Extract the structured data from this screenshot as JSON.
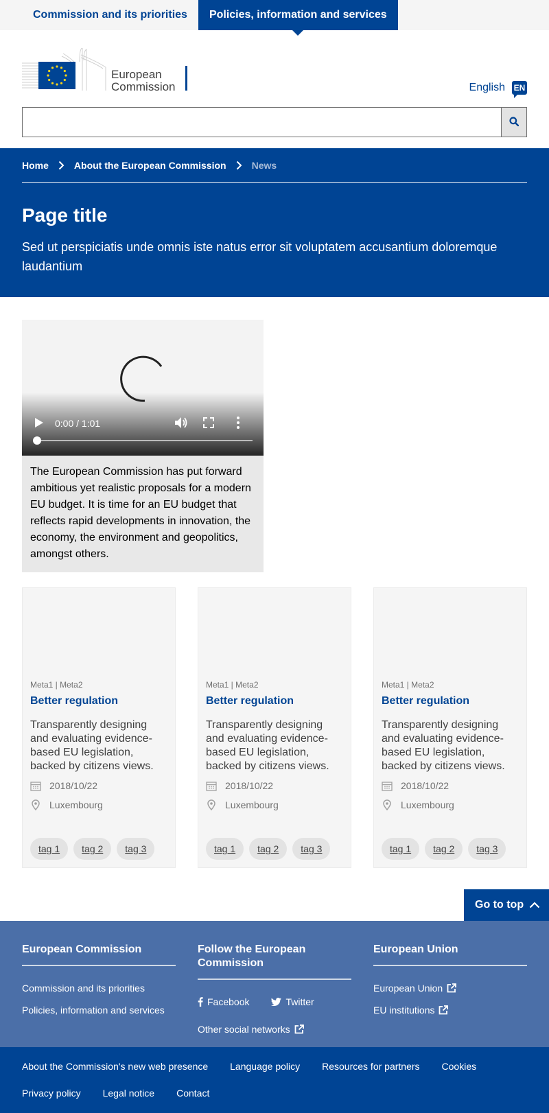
{
  "topnav": {
    "items": [
      {
        "label": "Commission and its priorities"
      },
      {
        "label": "Policies, information and services"
      }
    ]
  },
  "header": {
    "logo_line1": "European",
    "logo_line2": "Commission",
    "language_label": "English",
    "language_code": "EN",
    "search_placeholder": ""
  },
  "breadcrumb": [
    {
      "label": "Home"
    },
    {
      "label": "About the European Commission"
    },
    {
      "label": "News"
    }
  ],
  "page": {
    "title": "Page title",
    "intro": "Sed ut perspiciatis unde omnis iste natus error sit voluptatem accusantium doloremque laudantium"
  },
  "video": {
    "time": "0:00 / 1:01",
    "progress": 0,
    "caption": "The European Commission has put forward ambitious yet realistic proposals for a modern EU budget. It is time for an EU budget that reflects rapid developments in innovation, the economy, the environment and geopolitics, amongst others."
  },
  "cards": [
    {
      "meta": "Meta1 | Meta2",
      "title": "Better regulation",
      "description": "Transparently designing and evaluating evidence-based EU legislation, backed by citizens views.",
      "date": "2018/10/22",
      "location": "Luxembourg",
      "tags": [
        "tag 1",
        "tag 2",
        "tag 3"
      ]
    },
    {
      "meta": "Meta1 | Meta2",
      "title": "Better regulation",
      "description": "Transparently designing and evaluating evidence-based EU legislation, backed by citizens views.",
      "date": "2018/10/22",
      "location": "Luxembourg",
      "tags": [
        "tag 1",
        "tag 2",
        "tag 3"
      ]
    },
    {
      "meta": "Meta1 | Meta2",
      "title": "Better regulation",
      "description": "Transparently designing and evaluating evidence-based EU legislation, backed by citizens views.",
      "date": "2018/10/22",
      "location": "Luxembourg",
      "tags": [
        "tag 1",
        "tag 2",
        "tag 3"
      ]
    }
  ],
  "go_to_top": "Go to top",
  "footer": {
    "columns": [
      {
        "title": "European Commission",
        "links": [
          "Commission and its priorities",
          "Policies, information and services"
        ]
      },
      {
        "title": "Follow the European Commission",
        "social": [
          "Facebook",
          "Twitter"
        ],
        "other": "Other social networks"
      },
      {
        "title": "European Union",
        "links": [
          "European Union",
          "EU institutions"
        ]
      }
    ],
    "bottom_links": [
      "About the Commission's new web presence",
      "Language policy",
      "Resources for partners",
      "Cookies",
      "Privacy policy",
      "Legal notice",
      "Contact"
    ]
  },
  "colors": {
    "primary": "#004494",
    "footer_light": "#4b6fa8",
    "flag_yellow": "#ffd617"
  }
}
